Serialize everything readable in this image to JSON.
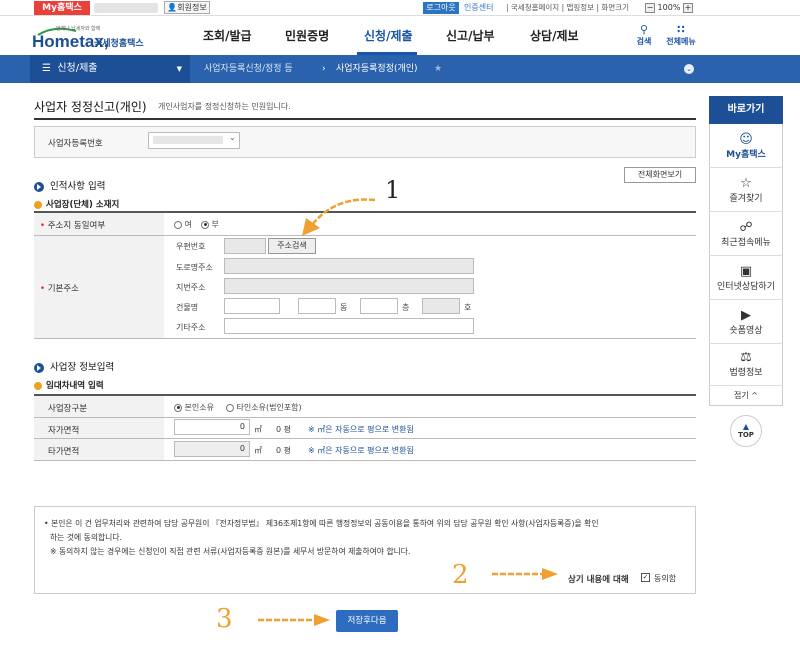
{
  "topbar": {
    "myhometax": "My홈택스",
    "member_info": "회원정보",
    "logout": "로그아웃",
    "cert_center": "인증센터",
    "links": "| 국세청홈페이지 | 맵핑정보 | 화면크기",
    "zoom": "100%",
    "zoom_minus": "−",
    "zoom_plus": "+"
  },
  "gnb": {
    "logo_small": "언제나 납세자와 함께",
    "logo_main": "Hometax,",
    "logo_sub": "국세청홈택스",
    "menus": [
      "조회/발급",
      "민원증명",
      "신청/제출",
      "신고/납부",
      "상담/제보"
    ],
    "active_menu": "신청/제출",
    "search": "검색",
    "all_menu": "전체메뉴"
  },
  "location": {
    "first": "신청/제출",
    "second": "사업자등록신청/정정 등",
    "third": "사업자등록정정(개인)"
  },
  "page": {
    "title": "사업자 정정신고(개인)",
    "description": "개인사업자를 정정신청하는 민원입니다.",
    "biz_number_label": "사업자등록번호",
    "full_view_button": "전체화면보기"
  },
  "section1": {
    "title": "인적사항 입력",
    "subtitle": "사업장(단체) 소재지",
    "same_address_label": "주소지 동일여부",
    "yes": "여",
    "no": "부",
    "basic_address_label": "기본주소",
    "zipcode_label": "우편번호",
    "address_search_button": "주소검색",
    "road_address_label": "도로명주소",
    "lot_address_label": "지번주소",
    "building_label": "건물명",
    "dong_suffix": "동",
    "floor_suffix": "층",
    "ho_suffix": "호",
    "other_address_label": "기타주소"
  },
  "section2": {
    "title": "사업장 정보입력",
    "subtitle": "임대차내역 입력",
    "site_type_label": "사업장구분",
    "own": "본인소유",
    "other_own": "타인소유(법인포함)",
    "self_area_label": "자가면적",
    "self_area_value": "0",
    "rent_area_label": "타가면적",
    "rent_area_value": "0",
    "area_unit": "㎡",
    "pyeong_text": "0 평",
    "convert_note": "※ ㎡은 자동으로 평으로 변환됨"
  },
  "consent": {
    "line1": "• 본인은 이 건 업무처리와 관련하여 담당 공무원이 『전자정부법』 제36조제1항에 따른 행정정보의 공동이용을 통하여 위의 담당 공무원 확인 사항(사업자등록증)을 확인",
    "line2": "하는 것에 동의합니다.",
    "line3": "※  동의하지 않는 경우에는 신청인이 직접 관련 서류(사업자등록증 원본)를 세무서 방문하여 제출하여야 합니다.",
    "agree_label": "상기 내용에 대해",
    "agree_text": "동의함",
    "agree_checked": true
  },
  "submit_button": "저장후다음",
  "annotations": {
    "one": "1",
    "two": "2",
    "three": "3"
  },
  "annotation_color": "#f0a030",
  "sidebar": {
    "title": "바로가기",
    "items": [
      "My홈택스",
      "즐겨찾기",
      "최근접속메뉴",
      "인터넷상담하기",
      "숏폼영상",
      "법령정보"
    ],
    "fold": "접기 ^",
    "top": "TOP"
  },
  "colors": {
    "primary": "#1d4f96",
    "accent": "#2a62ad",
    "brand_red": "#e8413b"
  }
}
